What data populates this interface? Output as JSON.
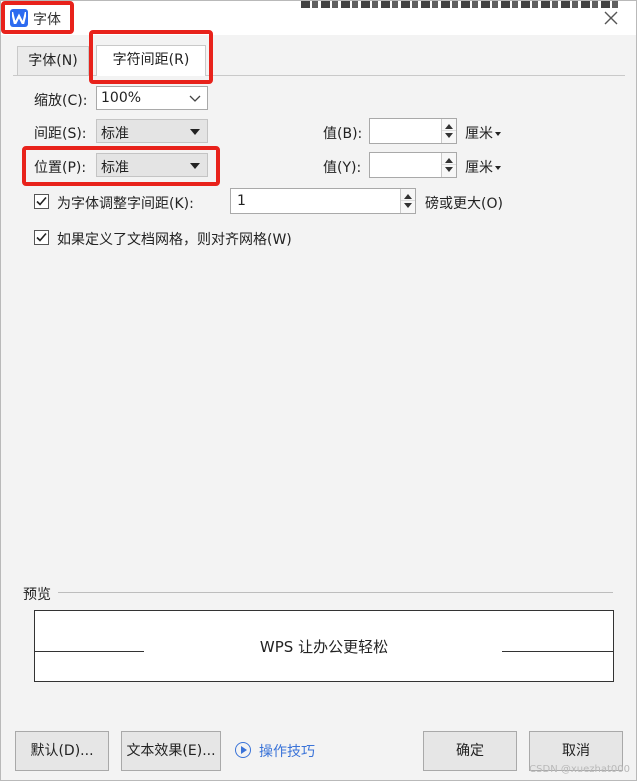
{
  "window": {
    "title": "字体",
    "bleed_text": ""
  },
  "tabs": [
    {
      "label": "字体(N)"
    },
    {
      "label": "字符间距(R)"
    }
  ],
  "form": {
    "scale_label": "缩放(C):",
    "scale_value": "100%",
    "spacing_label": "间距(S):",
    "spacing_value": "标准",
    "spacing_by_label": "值(B):",
    "spacing_by_value": "",
    "spacing_unit": "厘米",
    "position_label": "位置(P):",
    "position_value": "标准",
    "position_by_label": "值(Y):",
    "position_by_value": "",
    "position_unit": "厘米",
    "kerning_label": "为字体调整字间距(K):",
    "kerning_value": "1",
    "kerning_suffix": "磅或更大(O)",
    "kerning_checked": true,
    "grid_label": "如果定义了文档网格，则对齐网格(W)",
    "grid_checked": true
  },
  "preview": {
    "label": "预览",
    "text": "WPS 让办公更轻松"
  },
  "buttons": {
    "default": "默认(D)...",
    "text_effects": "文本效果(E)...",
    "tips": "操作技巧",
    "ok": "确定",
    "cancel": "取消"
  },
  "watermark": "CSDN @xuezhat000",
  "colors": {
    "accent": "#2d6bf0",
    "annotation_red": "#e8221b",
    "link_blue": "#3a73d8"
  }
}
